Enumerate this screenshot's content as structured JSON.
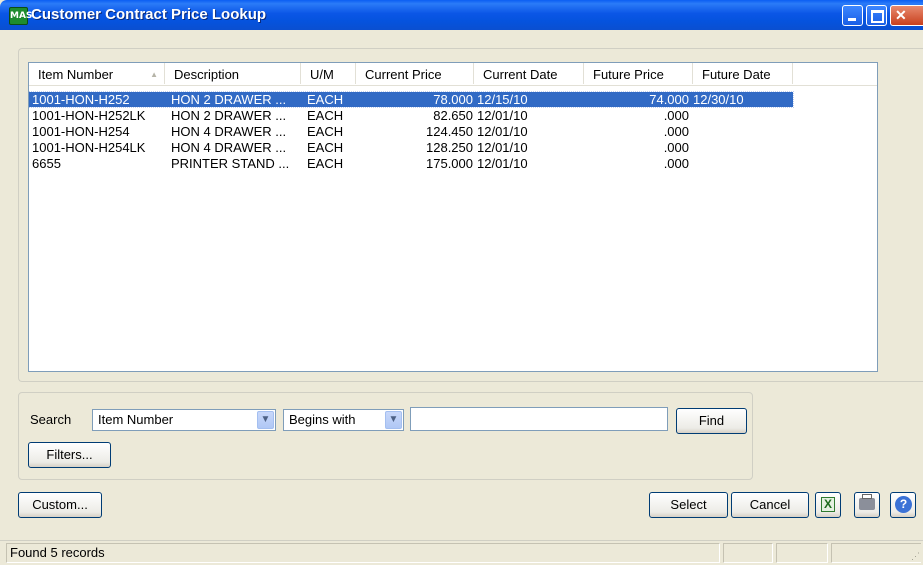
{
  "window": {
    "title": "Customer Contract Price Lookup",
    "app_icon": "MAS"
  },
  "table": {
    "columns": [
      "Item Number",
      "Description",
      "U/M",
      "Current Price",
      "Current Date",
      "Future Price",
      "Future Date"
    ],
    "rows": [
      {
        "item": "1001-HON-H252",
        "desc": "HON 2 DRAWER ...",
        "um": "EACH",
        "cur_price": "78.000",
        "cur_date": "12/15/10",
        "fut_price": "74.000",
        "fut_date": "12/30/10"
      },
      {
        "item": "1001-HON-H252LK",
        "desc": "HON 2 DRAWER ...",
        "um": "EACH",
        "cur_price": "82.650",
        "cur_date": "12/01/10",
        "fut_price": ".000",
        "fut_date": ""
      },
      {
        "item": "1001-HON-H254",
        "desc": "HON 4 DRAWER ...",
        "um": "EACH",
        "cur_price": "124.450",
        "cur_date": "12/01/10",
        "fut_price": ".000",
        "fut_date": ""
      },
      {
        "item": "1001-HON-H254LK",
        "desc": "HON 4 DRAWER ...",
        "um": "EACH",
        "cur_price": "128.250",
        "cur_date": "12/01/10",
        "fut_price": ".000",
        "fut_date": ""
      },
      {
        "item": "6655",
        "desc": "PRINTER STAND ...",
        "um": "EACH",
        "cur_price": "175.000",
        "cur_date": "12/01/10",
        "fut_price": ".000",
        "fut_date": ""
      }
    ]
  },
  "search": {
    "label": "Search",
    "field_value": "Item Number",
    "operator_value": "Begins with",
    "query_value": "",
    "find_label": "Find",
    "filters_label": "Filters..."
  },
  "buttons": {
    "custom": "Custom...",
    "select": "Select",
    "cancel": "Cancel"
  },
  "status": {
    "text": "Found 5 records"
  }
}
